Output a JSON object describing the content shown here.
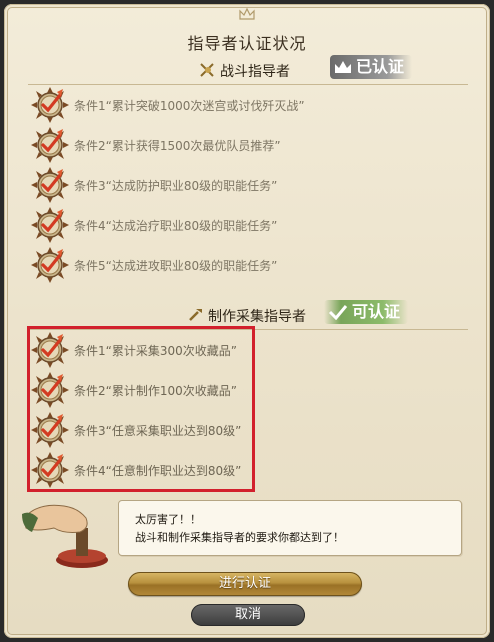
{
  "window": {
    "title": "指导者认证状况"
  },
  "combat": {
    "label": "战斗指导者",
    "badge": "已认证",
    "conditions": [
      "条件1“累计突破1000次迷宫或讨伐歼灭战”",
      "条件2“累计获得1500次最优队员推荐”",
      "条件3“达成防护职业80级的职能任务”",
      "条件4“达成治疗职业80级的职能任务”",
      "条件5“达成进攻职业80级的职能任务”"
    ]
  },
  "crafting": {
    "label": "制作采集指导者",
    "badge": "可认证",
    "conditions": [
      "条件1“累计采集300次收藏品”",
      "条件2“累计制作100次收藏品”",
      "条件3“任意采集职业达到80级”",
      "条件4“任意制作职业达到80级”"
    ]
  },
  "dialog": {
    "line1": "太厉害了！！",
    "line2": "战斗和制作采集指导者的要求你都达到了！"
  },
  "buttons": {
    "confirm": "进行认证",
    "cancel": "取消"
  },
  "colors": {
    "highlight": "#d2202c",
    "confirm_button": "#b8913e",
    "badge_ok": "#8cbb6a",
    "badge_done": "#9a9a9a"
  }
}
